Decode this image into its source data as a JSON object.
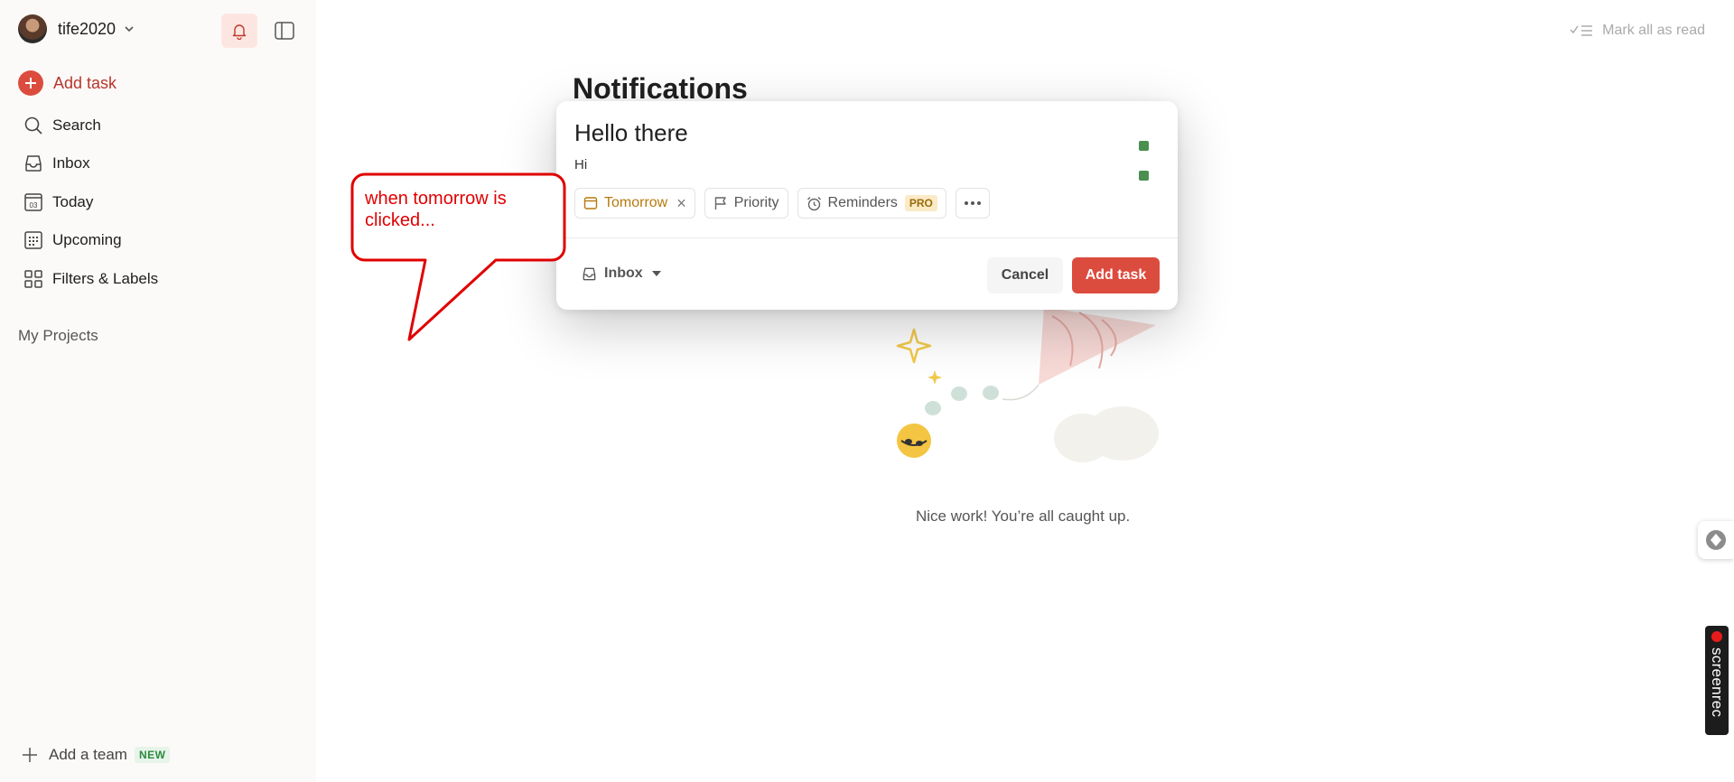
{
  "sidebar": {
    "username": "tife2020",
    "add_task_label": "Add task",
    "nav": [
      {
        "label": "Search",
        "icon": "search-icon"
      },
      {
        "label": "Inbox",
        "icon": "inbox-icon"
      },
      {
        "label": "Today",
        "icon": "calendar-today-icon",
        "day": "03"
      },
      {
        "label": "Upcoming",
        "icon": "calendar-grid-icon"
      },
      {
        "label": "Filters & Labels",
        "icon": "grid-icon"
      }
    ],
    "my_projects_label": "My Projects",
    "add_team_label": "Add a team",
    "new_badge": "NEW"
  },
  "header": {
    "mark_all_read_label": "Mark all as read"
  },
  "main": {
    "title": "Notifications",
    "empty_message": "Nice work! You’re all caught up."
  },
  "dialog": {
    "task_name": "Hello there",
    "description": "Hi",
    "date_chip": "Tomorrow",
    "priority_chip": "Priority",
    "reminders_chip": "Reminders",
    "pro_badge": "PRO",
    "project": "Inbox",
    "cancel_label": "Cancel",
    "add_label": "Add task"
  },
  "annotation": {
    "text": "when tomorrow is clicked..."
  },
  "widgets": {
    "screenrec_label": "screenrec"
  },
  "colors": {
    "accent": "#dc4c3e",
    "date_chip": "#b7790f",
    "sidebar_bg": "#fcfaf8",
    "annotation": "#e00000"
  }
}
